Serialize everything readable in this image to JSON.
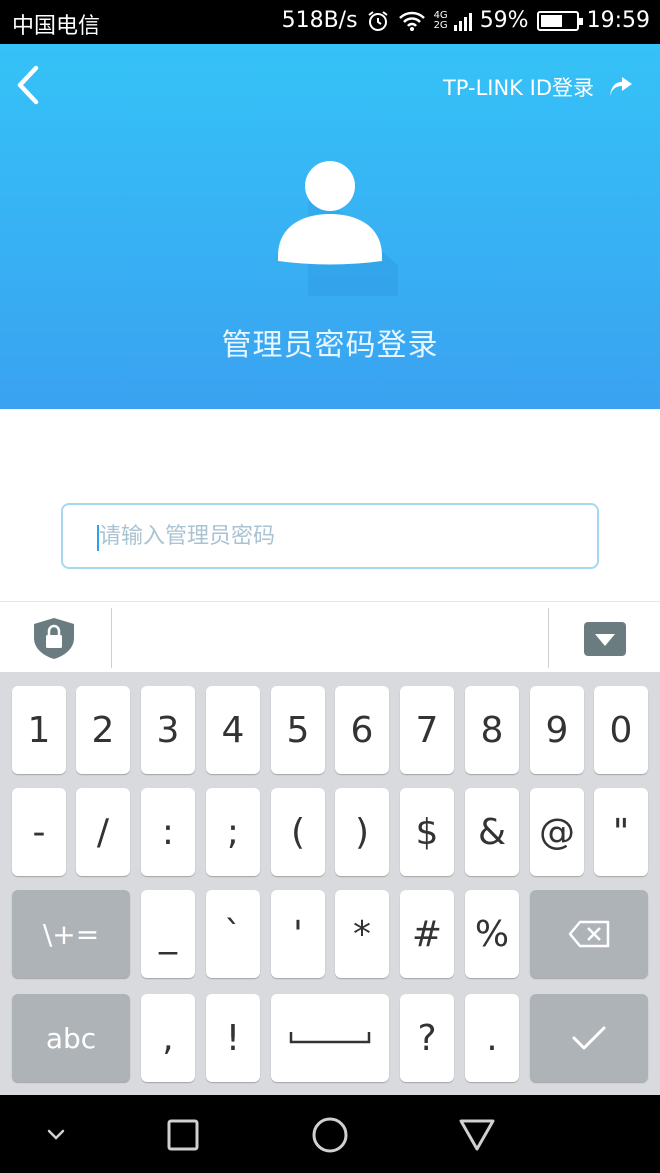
{
  "status_bar": {
    "carrier": "中国电信",
    "speed": "518B/s",
    "net_top": "4G",
    "net_bottom": "2G",
    "battery": "59%",
    "battery_level": 0.59,
    "time": "19:59"
  },
  "header": {
    "tp_login_label": "TP-LINK ID登录",
    "title": "管理员密码登录",
    "gradient_top": "#35c2f7",
    "gradient_bottom": "#3aa2f1"
  },
  "password": {
    "placeholder": "请输入管理员密码",
    "value": ""
  },
  "keyboard": {
    "row1": [
      "1",
      "2",
      "3",
      "4",
      "5",
      "6",
      "7",
      "8",
      "9",
      "0"
    ],
    "row2": [
      "-",
      "/",
      ":",
      ";",
      "(",
      ")",
      "$",
      "&",
      "@",
      "\""
    ],
    "row3": {
      "symbols_label": "\\+=",
      "keys": [
        "_",
        "`",
        "'",
        "*",
        "#",
        "%"
      ]
    },
    "row4": {
      "abc_label": "abc",
      "keys_left": [
        ",",
        "!"
      ],
      "keys_right": [
        "?",
        "."
      ]
    }
  },
  "icons": {
    "back": "chevron-left-icon",
    "tp_login": "share-arrow-icon",
    "avatar": "user-avatar-icon",
    "lock": "shield-lock-icon",
    "hide_keyboard": "keyboard-hide-icon",
    "backspace": "backspace-icon",
    "enter": "checkmark-icon"
  }
}
